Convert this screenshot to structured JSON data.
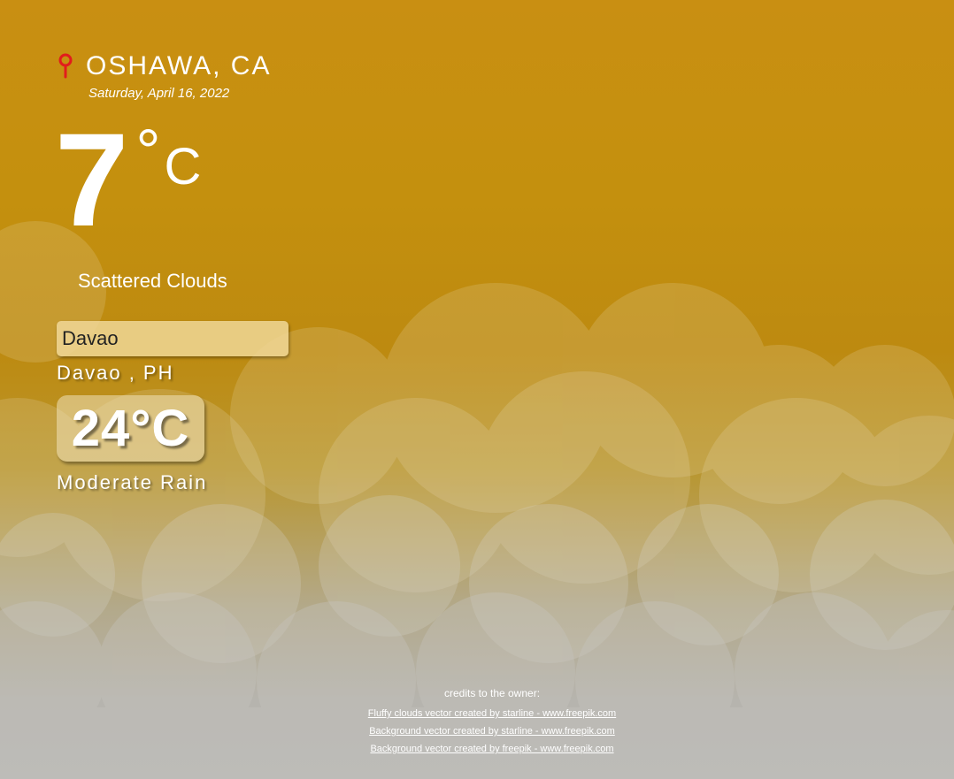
{
  "current": {
    "city": "OSHAWA, CA",
    "date": "Saturday, April 16, 2022",
    "temperature": "7",
    "degree_symbol": "°",
    "unit": "C",
    "description": "Scattered Clouds"
  },
  "search": {
    "input_value": "Davao",
    "result_city": "Davao , PH",
    "result_temperature": "24°C",
    "result_description": "Moderate Rain"
  },
  "credits": {
    "title": "credits to the owner:",
    "links": [
      "Fluffy clouds vector created by starline - www.freepik.com",
      "Background vector created by starline - www.freepik.com",
      "Background vector created by freepik - www.freepik.com"
    ]
  },
  "icons": {
    "location": "map-pin-icon"
  },
  "colors": {
    "background_top": "#c98f12",
    "background_bottom": "#b8b7b4",
    "pin": "#e21c1c",
    "text": "#ffffff"
  }
}
